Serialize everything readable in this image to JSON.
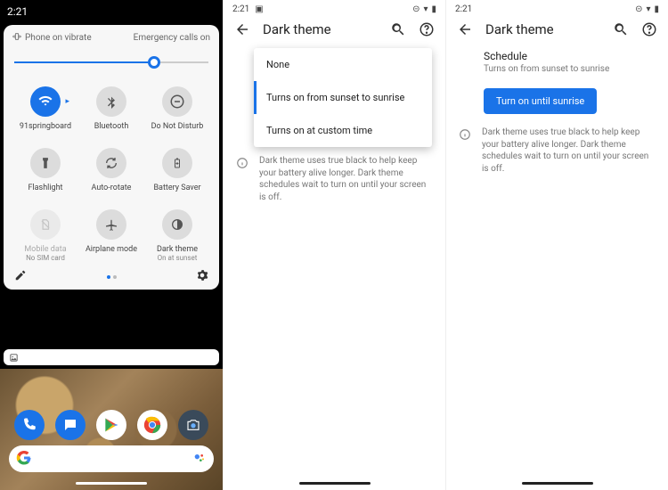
{
  "clock": "2:21",
  "panel1": {
    "header_left": "Phone on vibrate",
    "header_right": "Emergency calls on",
    "brightness_pct": 72,
    "tiles": [
      {
        "id": "wifi",
        "label": "91springboard",
        "active": true
      },
      {
        "id": "bluetooth",
        "label": "Bluetooth"
      },
      {
        "id": "dnd",
        "label": "Do Not Disturb"
      },
      {
        "id": "flashlight",
        "label": "Flashlight"
      },
      {
        "id": "autorotate",
        "label": "Auto-rotate"
      },
      {
        "id": "battery-saver",
        "label": "Battery Saver"
      },
      {
        "id": "mobile-data",
        "label": "Mobile data",
        "sub": "No SIM card",
        "dim": true
      },
      {
        "id": "airplane",
        "label": "Airplane mode"
      },
      {
        "id": "dark-theme",
        "label": "Dark theme",
        "sub": "On at sunset"
      }
    ]
  },
  "settings": {
    "title": "Dark theme",
    "schedule_label": "Schedule",
    "schedule_value": "Turns on from sunset to sunrise",
    "button": "Turn on until sunrise",
    "info": "Dark theme uses true black to help keep your battery alive longer. Dark theme schedules wait to turn on until your screen is off.",
    "options": [
      "None",
      "Turns on from sunset to sunrise",
      "Turns on at custom time"
    ]
  }
}
